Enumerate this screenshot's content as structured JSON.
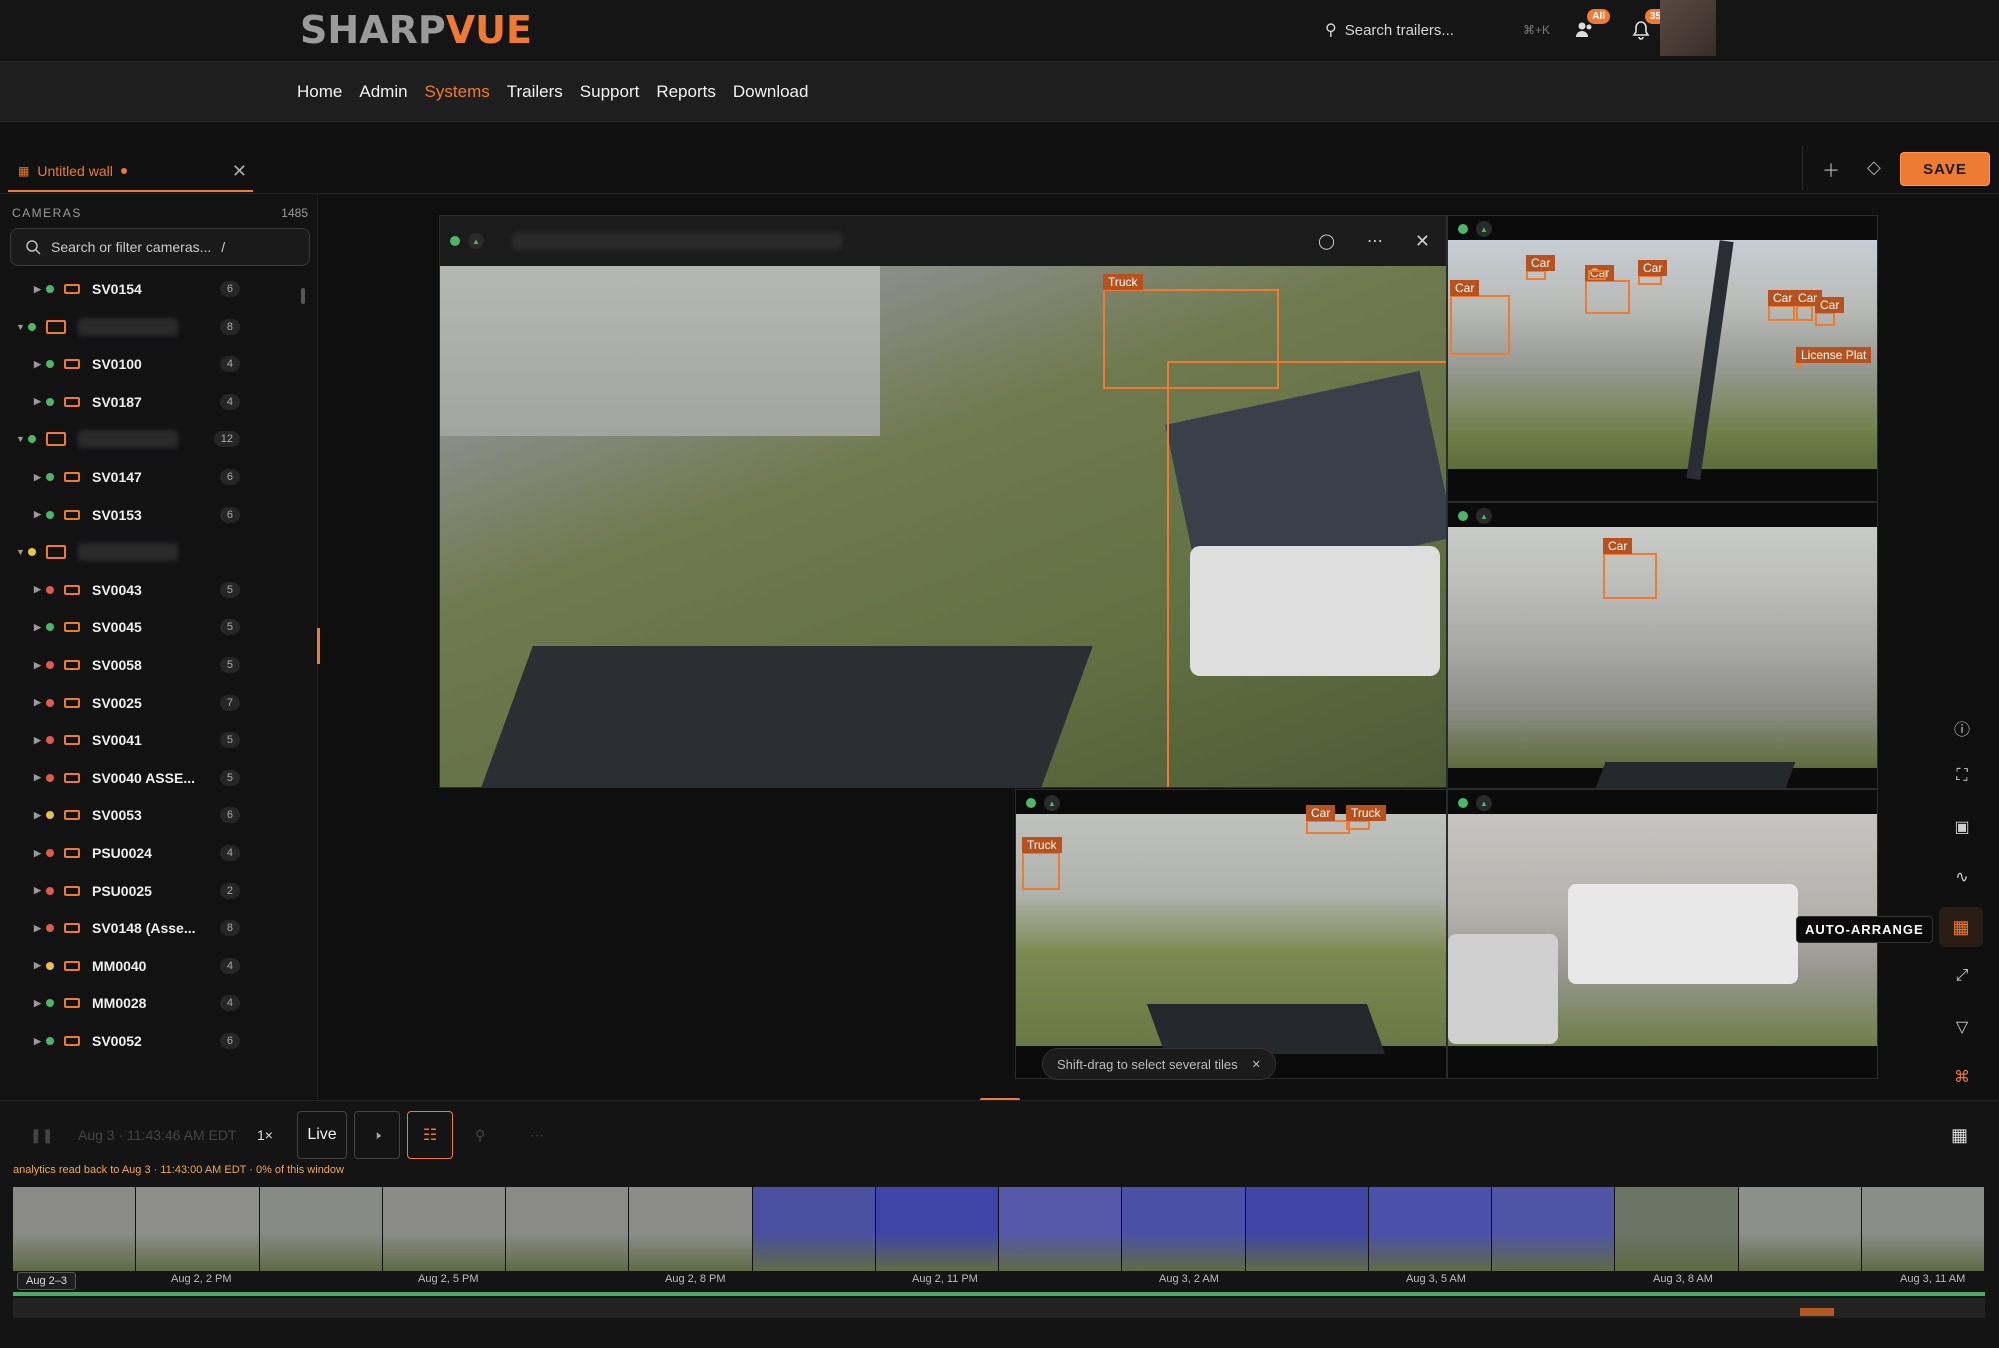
{
  "header": {
    "logo_part1": "SHARP",
    "logo_part2": "VUE",
    "search_placeholder": "Search trailers...",
    "search_shortcut": "⌘+K",
    "users_badge": "All",
    "notif_badge": "35"
  },
  "nav": {
    "items": [
      "Home",
      "Admin",
      "Systems",
      "Trailers",
      "Support",
      "Reports",
      "Download"
    ],
    "active": "Systems"
  },
  "wall": {
    "title": "Untitled wall",
    "save_label": "SAVE"
  },
  "sidebar": {
    "header": "CAMERAS",
    "count": "1485",
    "search_placeholder": "Search or filter cameras...",
    "search_shortcut": "/",
    "rows": [
      {
        "type": "cam",
        "name": "SV0154",
        "count": "6",
        "status": "#4db66b"
      },
      {
        "type": "group",
        "count": "8",
        "status": "#4db66b"
      },
      {
        "type": "cam",
        "name": "SV0100",
        "count": "4",
        "status": "#4db66b"
      },
      {
        "type": "cam",
        "name": "SV0187",
        "count": "4",
        "status": "#4db66b"
      },
      {
        "type": "group",
        "count": "12",
        "status": "#4db66b"
      },
      {
        "type": "cam",
        "name": "SV0147",
        "count": "6",
        "status": "#4db66b"
      },
      {
        "type": "cam",
        "name": "SV0153",
        "count": "6",
        "status": "#4db66b"
      },
      {
        "type": "group",
        "count": "",
        "status": "#e6c24a"
      },
      {
        "type": "cam",
        "name": "SV0043",
        "count": "5",
        "status": "#e05a4d"
      },
      {
        "type": "cam",
        "name": "SV0045",
        "count": "5",
        "status": "#4db66b"
      },
      {
        "type": "cam",
        "name": "SV0058",
        "count": "5",
        "status": "#e05a4d"
      },
      {
        "type": "cam",
        "name": "SV0025",
        "count": "7",
        "status": "#e05a4d"
      },
      {
        "type": "cam",
        "name": "SV0041",
        "count": "5",
        "status": "#e05a4d"
      },
      {
        "type": "cam",
        "name": "SV0040 ASSE...",
        "count": "5",
        "status": "#e05a4d"
      },
      {
        "type": "cam",
        "name": "SV0053",
        "count": "6",
        "status": "#e6c24a"
      },
      {
        "type": "cam",
        "name": "PSU0024",
        "count": "4",
        "status": "#e05a4d"
      },
      {
        "type": "cam",
        "name": "PSU0025",
        "count": "2",
        "status": "#e05a4d"
      },
      {
        "type": "cam",
        "name": "SV0148 (Asse...",
        "count": "8",
        "status": "#e05a4d"
      },
      {
        "type": "cam",
        "name": "MM0040",
        "count": "4",
        "status": "#e6c24a"
      },
      {
        "type": "cam",
        "name": "MM0028",
        "count": "4",
        "status": "#4db66b"
      },
      {
        "type": "cam",
        "name": "SV0052",
        "count": "6",
        "status": "#4db66b"
      }
    ]
  },
  "tiles": {
    "detections": {
      "main": [
        "Truck"
      ],
      "top_right": [
        "Car",
        "Car",
        "Car",
        "Car",
        "Car",
        "Car",
        "Car",
        "License Plat"
      ],
      "mid_right": [
        "Car"
      ],
      "bottom_mid": [
        "Truck",
        "Car",
        "Truck"
      ]
    }
  },
  "tools": {
    "auto_arrange": "AUTO-ARRANGE",
    "shift_tip": "Shift-drag to select several tiles"
  },
  "playback": {
    "time": "Aug 3 · 11:43:46 AM EDT",
    "speed": "1×",
    "live": "Live",
    "analytics": "analytics read back to Aug 3 · 11:43:00 AM EDT · 0% of this window",
    "range": "Aug 2–3",
    "ticks": [
      "Aug 2, 2 PM",
      "Aug 2, 5 PM",
      "Aug 2, 8 PM",
      "Aug 2, 11 PM",
      "Aug 3, 2 AM",
      "Aug 3, 5 AM",
      "Aug 3, 8 AM",
      "Aug 3, 11 AM"
    ]
  },
  "colors": {
    "accent": "#ef7b32",
    "online": "#4db66b",
    "offline": "#e05a4d",
    "warn": "#e6c24a"
  }
}
